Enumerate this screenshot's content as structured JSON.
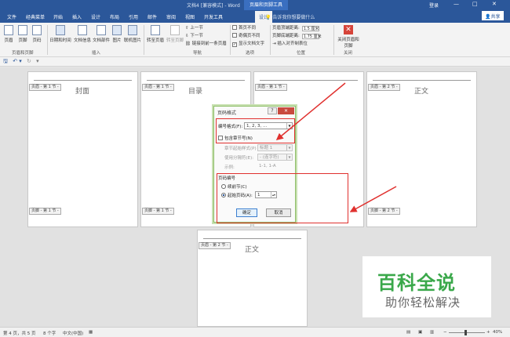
{
  "window": {
    "doc_title": "文档4 [兼容模式] - Word",
    "context_tab": "页眉和页脚工具",
    "login": "登录",
    "min": "—",
    "restore": "□",
    "close": "✕"
  },
  "tabs": [
    "文件",
    "经典菜单",
    "开始",
    "插入",
    "设计",
    "布局",
    "引用",
    "邮件",
    "审阅",
    "视图",
    "开发工具"
  ],
  "active_tab": "设计",
  "tell_me": "告诉我你想要做什么",
  "share": "共享",
  "ribbon": {
    "hf_group": {
      "header": "页眉",
      "footer": "页脚",
      "page_number": "页码",
      "label": "页眉和页脚"
    },
    "insert_group": {
      "date_time": "日期和时间",
      "doc_info": "文档信息",
      "doc_parts": "文档部件",
      "picture": "图片",
      "online_picture": "联机图片",
      "label": "插入"
    },
    "nav_group": {
      "goto_header": "转至页眉",
      "goto_footer": "转至页脚",
      "prev": "上一节",
      "next": "下一节",
      "link_prev": "链接到前一条页眉",
      "label": "导航"
    },
    "options_group": {
      "diff_first": "首页不同",
      "diff_odd_even": "奇偶页不同",
      "show_text": "显示文档文字",
      "label": "选项"
    },
    "position_group": {
      "header_top": "页眉顶端距离:",
      "header_top_val": "1.5 厘米",
      "footer_bottom": "页脚底端距离:",
      "footer_bottom_val": "1.75 厘米",
      "insert_align": "插入对齐制表位",
      "label": "位置"
    },
    "close_group": {
      "close": "关闭页眉和页脚",
      "label": "关闭"
    }
  },
  "qat": {
    "save": "🖫",
    "undo": "↶ ▾",
    "redo": "↻",
    "more": "▾"
  },
  "pages": {
    "p1": {
      "tag": "页眉 - 第 1 节 -",
      "title": "封面",
      "footer_tag": "页脚 - 第 1 节 -"
    },
    "p2": {
      "tag": "页眉 - 第 1 节 -",
      "title": "目录",
      "footer_tag": "页脚 - 第 1 节 -"
    },
    "p3": {
      "tag": "页眉 - 第 1 节 -"
    },
    "p4": {
      "tag": "页眉 - 第 2 节 -",
      "title": "正文",
      "footer_tag": "页脚 - 第 2 节 -"
    },
    "p5": {
      "tag": "页眉 - 第 2 节 -",
      "title": "正文"
    }
  },
  "dialog": {
    "title": "页码格式",
    "help": "?",
    "close": "✕",
    "number_format_label": "编号格式(F):",
    "number_format_value": "1, 2, 3, ...",
    "include_chapter": "包含章节号(N)",
    "chapter_style_label": "章节起始样式(P)",
    "chapter_style_value": "标题 1",
    "separator_label": "使用分隔符(E):",
    "separator_value": "- (连字符)",
    "example_label": "示例:",
    "example_value": "1-1, 1-A",
    "numbering_label": "页码编号",
    "continue_label": "续前节(C)",
    "start_at_label": "起始页码(A):",
    "start_at_value": "1",
    "ok": "确定",
    "cancel": "取消"
  },
  "status": {
    "page": "第 4 页，共 5 页",
    "words": "8 个字",
    "lang": "中文(中国)",
    "zoom": "40%"
  },
  "watermark": {
    "big": "百科全说",
    "small": "助你轻松解决"
  },
  "colors": {
    "accent": "#2b579a",
    "annotation": "#e0302e",
    "logo_green": "#3aa84a"
  }
}
